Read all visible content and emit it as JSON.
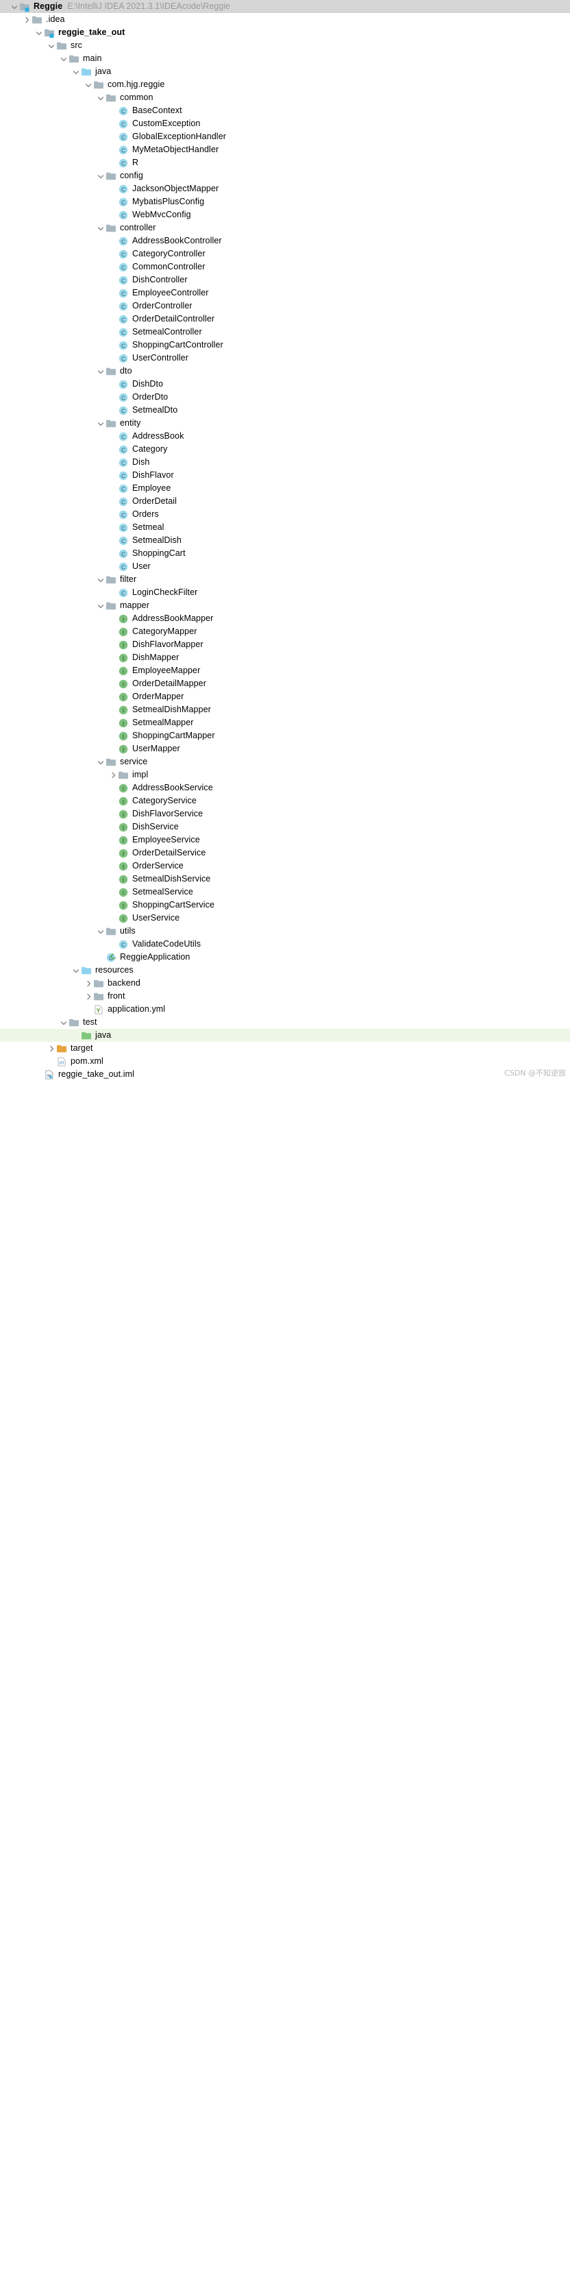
{
  "header": {
    "name": "Reggie",
    "path": "E:\\IntelliJ IDEA 2021.3.1\\IDEAcode\\Reggie",
    "icon": "module-folder-icon"
  },
  "watermark": "CSDN @不知逆旅",
  "colors": {
    "header_bg": "#d6d6d6",
    "folder_gray": "#a9b7c0",
    "folder_source_blue": "#8fd3ef",
    "folder_excluded_orange": "#e8a33d",
    "class_icon": "#9ad9ea",
    "interface_icon": "#7dc07d",
    "selected_row_green": "#eef7e5",
    "path_text": "#9a9a9a",
    "chevron": "#868686"
  },
  "tree": [
    {
      "label": ".idea",
      "depth": 1,
      "icon": "folder-gray-icon",
      "state": "collapsed"
    },
    {
      "label": "reggie_take_out",
      "depth": 2,
      "icon": "module-folder-icon",
      "state": "expanded",
      "bold": true
    },
    {
      "label": "src",
      "depth": 3,
      "icon": "folder-gray-icon",
      "state": "expanded"
    },
    {
      "label": "main",
      "depth": 4,
      "icon": "folder-gray-icon",
      "state": "expanded"
    },
    {
      "label": "java",
      "depth": 5,
      "icon": "folder-source-icon",
      "state": "expanded"
    },
    {
      "label": "com.hjg.reggie",
      "depth": 6,
      "icon": "package-icon",
      "state": "expanded"
    },
    {
      "label": "common",
      "depth": 7,
      "icon": "package-icon",
      "state": "expanded"
    },
    {
      "label": "BaseContext",
      "depth": 8,
      "icon": "class-icon",
      "state": "leaf"
    },
    {
      "label": "CustomException",
      "depth": 8,
      "icon": "class-icon",
      "state": "leaf"
    },
    {
      "label": "GlobalExceptionHandler",
      "depth": 8,
      "icon": "class-icon",
      "state": "leaf"
    },
    {
      "label": "MyMetaObjectHandler",
      "depth": 8,
      "icon": "class-icon",
      "state": "leaf"
    },
    {
      "label": "R",
      "depth": 8,
      "icon": "class-icon",
      "state": "leaf"
    },
    {
      "label": "config",
      "depth": 7,
      "icon": "package-icon",
      "state": "expanded"
    },
    {
      "label": "JacksonObjectMapper",
      "depth": 8,
      "icon": "class-icon",
      "state": "leaf"
    },
    {
      "label": "MybatisPlusConfig",
      "depth": 8,
      "icon": "class-icon",
      "state": "leaf"
    },
    {
      "label": "WebMvcConfig",
      "depth": 8,
      "icon": "class-icon",
      "state": "leaf"
    },
    {
      "label": "controller",
      "depth": 7,
      "icon": "package-icon",
      "state": "expanded"
    },
    {
      "label": "AddressBookController",
      "depth": 8,
      "icon": "class-icon",
      "state": "leaf"
    },
    {
      "label": "CategoryController",
      "depth": 8,
      "icon": "class-icon",
      "state": "leaf"
    },
    {
      "label": "CommonController",
      "depth": 8,
      "icon": "class-icon",
      "state": "leaf"
    },
    {
      "label": "DishController",
      "depth": 8,
      "icon": "class-icon",
      "state": "leaf"
    },
    {
      "label": "EmployeeController",
      "depth": 8,
      "icon": "class-icon",
      "state": "leaf"
    },
    {
      "label": "OrderController",
      "depth": 8,
      "icon": "class-icon",
      "state": "leaf"
    },
    {
      "label": "OrderDetailController",
      "depth": 8,
      "icon": "class-icon",
      "state": "leaf"
    },
    {
      "label": "SetmealController",
      "depth": 8,
      "icon": "class-icon",
      "state": "leaf"
    },
    {
      "label": "ShoppingCartController",
      "depth": 8,
      "icon": "class-icon",
      "state": "leaf"
    },
    {
      "label": "UserController",
      "depth": 8,
      "icon": "class-icon",
      "state": "leaf"
    },
    {
      "label": "dto",
      "depth": 7,
      "icon": "package-icon",
      "state": "expanded"
    },
    {
      "label": "DishDto",
      "depth": 8,
      "icon": "class-icon",
      "state": "leaf"
    },
    {
      "label": "OrderDto",
      "depth": 8,
      "icon": "class-icon",
      "state": "leaf"
    },
    {
      "label": "SetmealDto",
      "depth": 8,
      "icon": "class-icon",
      "state": "leaf"
    },
    {
      "label": "entity",
      "depth": 7,
      "icon": "package-icon",
      "state": "expanded"
    },
    {
      "label": "AddressBook",
      "depth": 8,
      "icon": "class-icon",
      "state": "leaf"
    },
    {
      "label": "Category",
      "depth": 8,
      "icon": "class-icon",
      "state": "leaf"
    },
    {
      "label": "Dish",
      "depth": 8,
      "icon": "class-icon",
      "state": "leaf"
    },
    {
      "label": "DishFlavor",
      "depth": 8,
      "icon": "class-icon",
      "state": "leaf"
    },
    {
      "label": "Employee",
      "depth": 8,
      "icon": "class-icon",
      "state": "leaf"
    },
    {
      "label": "OrderDetail",
      "depth": 8,
      "icon": "class-icon",
      "state": "leaf"
    },
    {
      "label": "Orders",
      "depth": 8,
      "icon": "class-icon",
      "state": "leaf"
    },
    {
      "label": "Setmeal",
      "depth": 8,
      "icon": "class-icon",
      "state": "leaf"
    },
    {
      "label": "SetmealDish",
      "depth": 8,
      "icon": "class-icon",
      "state": "leaf"
    },
    {
      "label": "ShoppingCart",
      "depth": 8,
      "icon": "class-icon",
      "state": "leaf"
    },
    {
      "label": "User",
      "depth": 8,
      "icon": "class-icon",
      "state": "leaf"
    },
    {
      "label": "filter",
      "depth": 7,
      "icon": "package-icon",
      "state": "expanded"
    },
    {
      "label": "LoginCheckFilter",
      "depth": 8,
      "icon": "class-icon",
      "state": "leaf"
    },
    {
      "label": "mapper",
      "depth": 7,
      "icon": "package-icon",
      "state": "expanded"
    },
    {
      "label": "AddressBookMapper",
      "depth": 8,
      "icon": "interface-icon",
      "state": "leaf"
    },
    {
      "label": "CategoryMapper",
      "depth": 8,
      "icon": "interface-icon",
      "state": "leaf"
    },
    {
      "label": "DishFlavorMapper",
      "depth": 8,
      "icon": "interface-icon",
      "state": "leaf"
    },
    {
      "label": "DishMapper",
      "depth": 8,
      "icon": "interface-icon",
      "state": "leaf"
    },
    {
      "label": "EmployeeMapper",
      "depth": 8,
      "icon": "interface-icon",
      "state": "leaf"
    },
    {
      "label": "OrderDetailMapper",
      "depth": 8,
      "icon": "interface-icon",
      "state": "leaf"
    },
    {
      "label": "OrderMapper",
      "depth": 8,
      "icon": "interface-icon",
      "state": "leaf"
    },
    {
      "label": "SetmealDishMapper",
      "depth": 8,
      "icon": "interface-icon",
      "state": "leaf"
    },
    {
      "label": "SetmealMapper",
      "depth": 8,
      "icon": "interface-icon",
      "state": "leaf"
    },
    {
      "label": "ShoppingCartMapper",
      "depth": 8,
      "icon": "interface-icon",
      "state": "leaf"
    },
    {
      "label": "UserMapper",
      "depth": 8,
      "icon": "interface-icon",
      "state": "leaf"
    },
    {
      "label": "service",
      "depth": 7,
      "icon": "package-icon",
      "state": "expanded"
    },
    {
      "label": "impl",
      "depth": 8,
      "icon": "package-icon",
      "state": "collapsed"
    },
    {
      "label": "AddressBookService",
      "depth": 8,
      "icon": "interface-icon",
      "state": "leaf"
    },
    {
      "label": "CategoryService",
      "depth": 8,
      "icon": "interface-icon",
      "state": "leaf"
    },
    {
      "label": "DishFlavorService",
      "depth": 8,
      "icon": "interface-icon",
      "state": "leaf"
    },
    {
      "label": "DishService",
      "depth": 8,
      "icon": "interface-icon",
      "state": "leaf"
    },
    {
      "label": "EmployeeService",
      "depth": 8,
      "icon": "interface-icon",
      "state": "leaf"
    },
    {
      "label": "OrderDetailService",
      "depth": 8,
      "icon": "interface-icon",
      "state": "leaf"
    },
    {
      "label": "OrderService",
      "depth": 8,
      "icon": "interface-icon",
      "state": "leaf"
    },
    {
      "label": "SetmealDishService",
      "depth": 8,
      "icon": "interface-icon",
      "state": "leaf"
    },
    {
      "label": "SetmealService",
      "depth": 8,
      "icon": "interface-icon",
      "state": "leaf"
    },
    {
      "label": "ShoppingCartService",
      "depth": 8,
      "icon": "interface-icon",
      "state": "leaf"
    },
    {
      "label": "UserService",
      "depth": 8,
      "icon": "interface-icon",
      "state": "leaf"
    },
    {
      "label": "utils",
      "depth": 7,
      "icon": "package-icon",
      "state": "expanded"
    },
    {
      "label": "ValidateCodeUtils",
      "depth": 8,
      "icon": "class-icon",
      "state": "leaf"
    },
    {
      "label": "ReggieApplication",
      "depth": 7,
      "icon": "spring-class-icon",
      "state": "leaf"
    },
    {
      "label": "resources",
      "depth": 5,
      "icon": "folder-resources-icon",
      "state": "expanded"
    },
    {
      "label": "backend",
      "depth": 6,
      "icon": "folder-gray-icon",
      "state": "collapsed"
    },
    {
      "label": "front",
      "depth": 6,
      "icon": "folder-gray-icon",
      "state": "collapsed"
    },
    {
      "label": "application.yml",
      "depth": 6,
      "icon": "yml-file-icon",
      "state": "leaf"
    },
    {
      "label": "test",
      "depth": 4,
      "icon": "folder-gray-icon",
      "state": "expanded"
    },
    {
      "label": "java",
      "depth": 5,
      "icon": "folder-test-icon",
      "state": "leaf",
      "selected": true
    },
    {
      "label": "target",
      "depth": 3,
      "icon": "folder-excluded-icon",
      "state": "collapsed"
    },
    {
      "label": "pom.xml",
      "depth": 3,
      "icon": "maven-file-icon",
      "state": "leaf"
    },
    {
      "label": "reggie_take_out.iml",
      "depth": 2,
      "icon": "iml-file-icon",
      "state": "leaf"
    }
  ]
}
